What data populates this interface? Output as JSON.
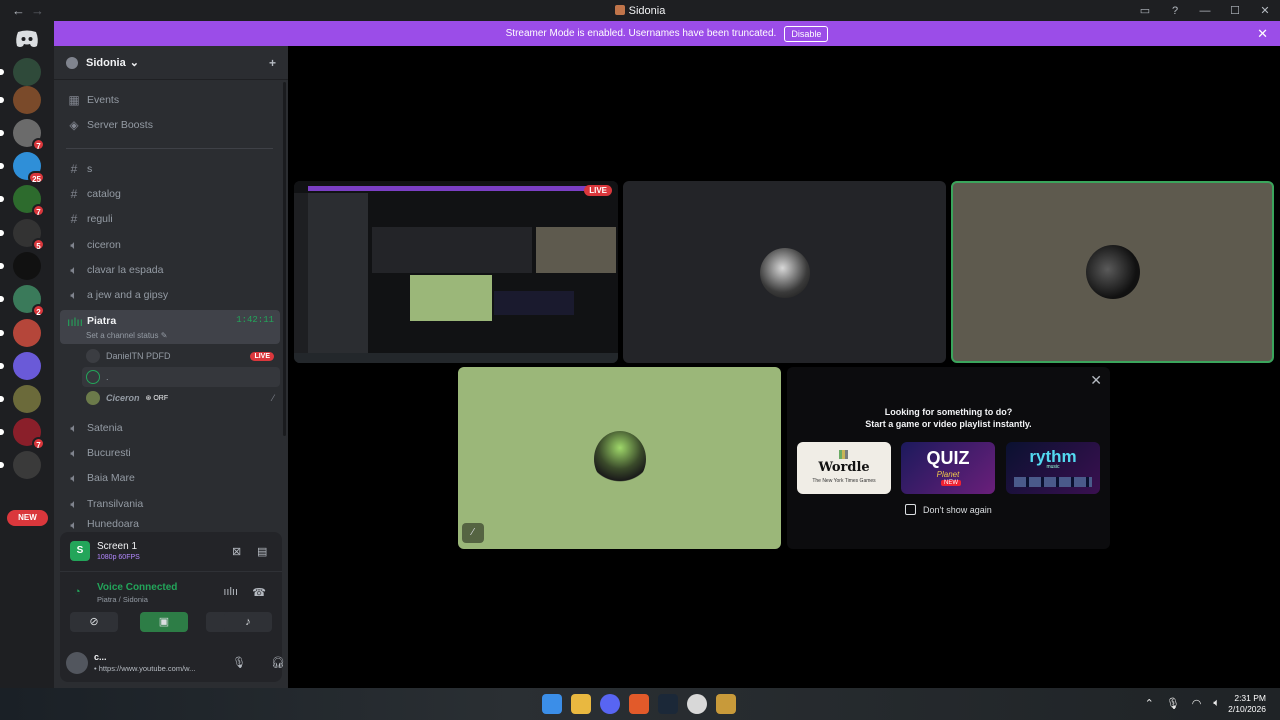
{
  "window": {
    "title": "Sidonia",
    "back_glyph": "←",
    "forward_glyph": "→",
    "controls": [
      "▭",
      "?",
      "—",
      "☐",
      "✕"
    ]
  },
  "banner": {
    "message": "Streamer Mode is enabled. Usernames have been truncated.",
    "button": "Disable",
    "close": "✕"
  },
  "rail": {
    "servers": [
      {
        "badge": "",
        "color": "#2f4a3a"
      },
      {
        "badge": "",
        "color": "#7a4a2a"
      },
      {
        "badge": "7",
        "color": "#6b6b6b"
      },
      {
        "badge": "25",
        "color": "#2f8fd8"
      },
      {
        "badge": "7",
        "color": "#2d6b2d"
      },
      {
        "badge": "5",
        "color": "#333"
      },
      {
        "badge": "",
        "color": "#111"
      },
      {
        "badge": "2",
        "color": "#3a7a5a"
      },
      {
        "badge": "",
        "color": "#b5463a"
      },
      {
        "badge": "",
        "color": "#6a5ad8"
      },
      {
        "badge": "",
        "color": "#6b6a3a"
      },
      {
        "badge": "7",
        "color": "#8a1f2a"
      },
      {
        "badge": "",
        "color": "#3a3a3a"
      }
    ],
    "new_label": "NEW"
  },
  "sidebar": {
    "server_name": "Sidonia",
    "server_chevron": "⌄",
    "add_member_icon": "+",
    "events": "Events",
    "boosts": "Server Boosts",
    "channels": [
      {
        "type": "text",
        "name": "s"
      },
      {
        "type": "text",
        "name": "catalog"
      },
      {
        "type": "text",
        "name": "reguli"
      },
      {
        "type": "voice",
        "name": "ciceron"
      },
      {
        "type": "voice",
        "name": "clavar la espada"
      },
      {
        "type": "voice",
        "name": "a jew and a gipsy"
      }
    ],
    "active_channel": {
      "name": "Piatra",
      "timer": "1:42:11",
      "status": "Set a channel status"
    },
    "members": [
      {
        "name": "DanielTN PDFD",
        "live": "LIVE"
      },
      {
        "name": "."
      },
      {
        "name": "Ciceron",
        "tag": "ORF"
      }
    ],
    "more_channels": [
      "Satenia",
      "Bucuresti",
      "Baia Mare",
      "Transilvania",
      "Hunedoara"
    ]
  },
  "panel": {
    "screen_letter": "S",
    "screen_name": "Screen 1",
    "screen_sub": "1080p 60FPS",
    "voice_status": "Voice Connected",
    "voice_location": "Piatra / Sidonia",
    "user_name": "c...",
    "user_status": "• https://www.youtube.com/w..."
  },
  "stage": {
    "live_label": "LIVE",
    "activity": {
      "line1": "Looking for something to do?",
      "line2": "Start a game or video playlist instantly.",
      "cards": {
        "wordle": "Wordle",
        "wordle_sub": "The New York Times Games",
        "quiz": "QUIZ",
        "quiz_sub": "Planet",
        "quiz_new": "NEW",
        "rythm": "rythm",
        "rythm_sub": "music"
      },
      "dont_show": "Don't show again"
    }
  },
  "taskbar": {
    "time": "2:31 PM",
    "date": "2/10/2026"
  },
  "colors": {
    "accent": "#9b4de8",
    "green": "#23a55a",
    "red": "#da373c"
  }
}
